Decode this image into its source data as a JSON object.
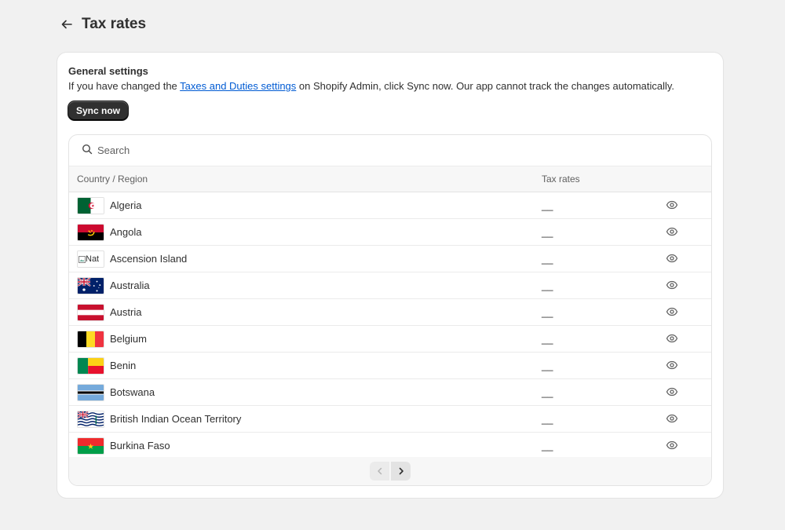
{
  "header": {
    "title": "Tax rates"
  },
  "general": {
    "heading": "General settings",
    "desc_before": "If you have changed the ",
    "desc_link": "Taxes and Duties settings",
    "desc_after": " on Shopify Admin, click Sync now. Our app cannot track the changes automatically.",
    "sync_label": "Sync now"
  },
  "search": {
    "placeholder": "Search",
    "value": ""
  },
  "table": {
    "col_country": "Country / Region",
    "col_rates": "Tax rates",
    "rows": [
      {
        "country": "Algeria",
        "rate": "__",
        "flag": "algeria-flag"
      },
      {
        "country": "Angola",
        "rate": "__",
        "flag": "angola-flag"
      },
      {
        "country": "Ascension Island",
        "rate": "__",
        "flag": "broken-image",
        "flag_alt": "Nat"
      },
      {
        "country": "Australia",
        "rate": "__",
        "flag": "australia-flag"
      },
      {
        "country": "Austria",
        "rate": "__",
        "flag": "austria-flag"
      },
      {
        "country": "Belgium",
        "rate": "__",
        "flag": "belgium-flag"
      },
      {
        "country": "Benin",
        "rate": "__",
        "flag": "benin-flag"
      },
      {
        "country": "Botswana",
        "rate": "__",
        "flag": "botswana-flag"
      },
      {
        "country": "British Indian Ocean Territory",
        "rate": "__",
        "flag": "biot-flag"
      },
      {
        "country": "Burkina Faso",
        "rate": "__",
        "flag": "burkina-faso-flag"
      }
    ]
  },
  "colors": {
    "primary_button": "#303030",
    "link": "#005bd3",
    "background": "#f1f1f1"
  }
}
